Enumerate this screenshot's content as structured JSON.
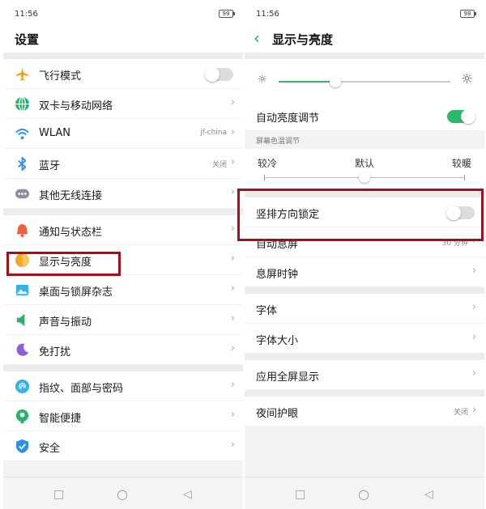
{
  "left": {
    "status": {
      "time": "11:56",
      "battery": "99"
    },
    "title": "设置",
    "groups": [
      [
        {
          "label": "飞行模式",
          "icon": "airplane-icon",
          "type": "toggle",
          "on": false
        },
        {
          "label": "双卡与移动网络",
          "icon": "globe-icon",
          "type": "chevron"
        },
        {
          "label": "WLAN",
          "icon": "wifi-icon",
          "type": "value",
          "value": "jf-china"
        },
        {
          "label": "蓝牙",
          "icon": "bluetooth-icon",
          "type": "value",
          "value": "关闭"
        },
        {
          "label": "其他无线连接",
          "icon": "more-connections-icon",
          "type": "chevron"
        }
      ],
      [
        {
          "label": "通知与状态栏",
          "icon": "bell-icon",
          "type": "chevron"
        },
        {
          "label": "显示与亮度",
          "icon": "display-icon",
          "type": "chevron"
        },
        {
          "label": "桌面与锁屏杂志",
          "icon": "wallpaper-icon",
          "type": "chevron"
        },
        {
          "label": "声音与振动",
          "icon": "speaker-icon",
          "type": "chevron"
        },
        {
          "label": "免打扰",
          "icon": "moon-icon",
          "type": "chevron"
        }
      ],
      [
        {
          "label": "指纹、面部与密码",
          "icon": "fingerprint-icon",
          "type": "chevron"
        },
        {
          "label": "智能便捷",
          "icon": "smart-icon",
          "type": "chevron"
        },
        {
          "label": "安全",
          "icon": "shield-icon",
          "type": "chevron"
        }
      ]
    ]
  },
  "right": {
    "status": {
      "time": "11:56",
      "battery": "98"
    },
    "title": "显示与亮度",
    "brightness_level": 0.33,
    "auto_brightness": {
      "label": "自动亮度调节",
      "on": true
    },
    "color_temp": {
      "caption": "屏幕色温调节",
      "cold": "较冷",
      "default": "默认",
      "warm": "较暖",
      "level": 0.5
    },
    "groups": [
      [
        {
          "label": "竖排方向锁定",
          "type": "toggle",
          "on": false
        },
        {
          "label": "自动息屏",
          "type": "value",
          "value": "30 分钟"
        },
        {
          "label": "息屏时钟",
          "type": "chevron"
        }
      ],
      [
        {
          "label": "字体",
          "type": "chevron"
        },
        {
          "label": "字体大小",
          "type": "chevron"
        }
      ],
      [
        {
          "label": "应用全屏显示",
          "type": "chevron"
        }
      ],
      [
        {
          "label": "夜间护眼",
          "type": "value",
          "value": "关闭"
        }
      ]
    ]
  },
  "colors": {
    "accent": "#2db86a",
    "highlight": "#a3101b"
  }
}
